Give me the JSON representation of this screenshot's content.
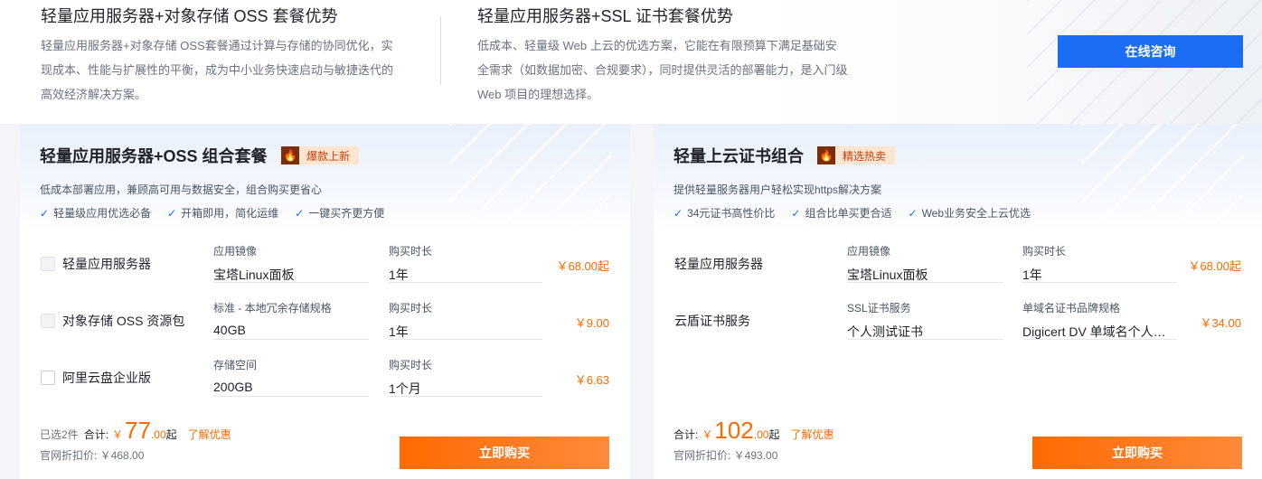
{
  "banner": {
    "adv1": {
      "title": "轻量应用服务器+对象存储 OSS 套餐优势",
      "desc": "轻量应用服务器+对象存储 OSS套餐通过计算与存储的协同优化，实现成本、性能与扩展性的平衡，成为中小业务快速启动与敏捷迭代的高效经济解决方案。"
    },
    "adv2": {
      "title": "轻量应用服务器+SSL 证书套餐优势",
      "desc": "低成本、轻量级 Web 上云的优选方案，它能在有限预算下满足基础安全需求（如数据加密、合规要求），同时提供灵活的部署能力，是入门级 Web 项目的理想选择。"
    },
    "consult_label": "在线咨询"
  },
  "left_card": {
    "title": "轻量应用服务器+OSS 组合套餐",
    "tag_icon": "fire-icon",
    "tag": "爆款上新",
    "subtitle": "低成本部署应用，兼顾高可用与数据安全，组合购买更省心",
    "features": [
      "轻量级应用优选必备",
      "开箱即用，简化运维",
      "一键买齐更方便"
    ],
    "rows": [
      {
        "name": "轻量应用服务器",
        "f1_label": "应用镜像",
        "f1_value": "宝塔Linux面板",
        "f2_label": "购买时长",
        "f2_value": "1年",
        "price": "￥68.00起"
      },
      {
        "name": "对象存储 OSS 资源包",
        "f1_label": "标准 - 本地冗余存储规格",
        "f1_value": "40GB",
        "f2_label": "购买时长",
        "f2_value": "1年",
        "price": "￥9.00"
      },
      {
        "name": "阿里云盘企业版",
        "f1_label": "存储空间",
        "f1_value": "200GB",
        "f2_label": "购买时长",
        "f2_value": "1个月",
        "price": "￥6.63"
      }
    ],
    "selected_count": "已选2件",
    "total_label": "合计:",
    "currency": "￥",
    "total_int": "77",
    "total_dec": ".00",
    "total_suffix": "起",
    "discount_link": "了解优惠",
    "official_price": "官网折扣价: ￥468.00",
    "buy_label": "立即购买"
  },
  "right_card": {
    "title": "轻量上云证书组合",
    "tag_icon": "fire-icon",
    "tag": "精选热卖",
    "subtitle": "提供轻量服务器用户轻松实现https解决方案",
    "features": [
      "34元证书高性价比",
      "组合比单买更合适",
      "Web业务安全上云优选"
    ],
    "rows": [
      {
        "name": "轻量应用服务器",
        "f1_label": "应用镜像",
        "f1_value": "宝塔Linux面板",
        "f2_label": "购买时长",
        "f2_value": "1年",
        "price": "￥68.00起"
      },
      {
        "name": "云盾证书服务",
        "f1_label": "SSL证书服务",
        "f1_value": "个人测试证书",
        "f2_label": "单域名证书品牌规格",
        "f2_value": "Digicert DV 单域名个人…",
        "price": "￥34.00"
      }
    ],
    "total_label": "合计:",
    "currency": "￥",
    "total_int": "102",
    "total_dec": ".00",
    "total_suffix": "起",
    "discount_link": "了解优惠",
    "official_price": "官网折扣价: ￥493.00",
    "buy_label": "立即购买"
  }
}
